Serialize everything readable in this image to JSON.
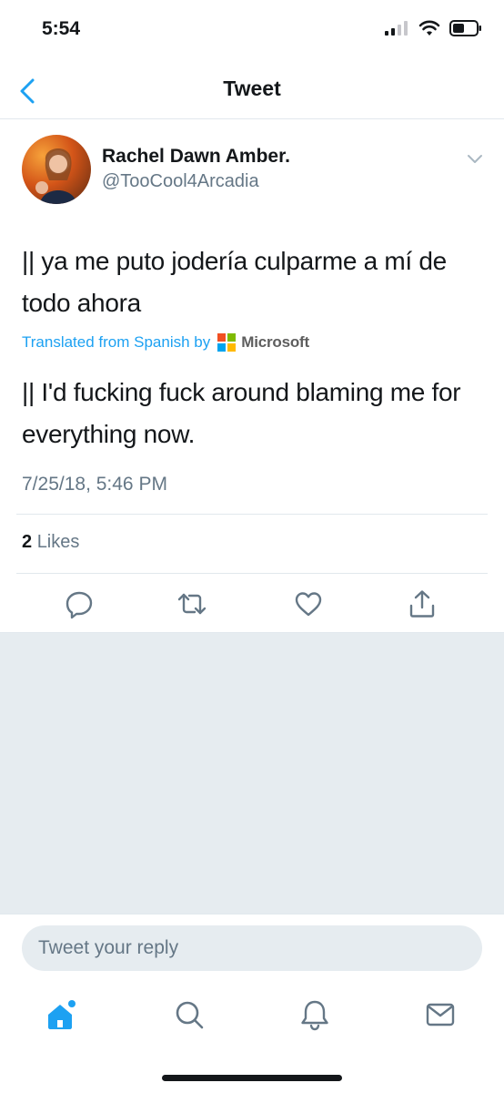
{
  "status_bar": {
    "time": "5:54"
  },
  "nav": {
    "title": "Tweet"
  },
  "tweet": {
    "author_name": "Rachel Dawn Amber.",
    "author_handle": "@TooCool4Arcadia",
    "text": "|| ya me puto jodería culparme a mí de todo ahora",
    "translated_label": "Translated from Spanish by",
    "translation_provider": "Microsoft",
    "translation": "|| I'd fucking fuck around blaming me for everything now.",
    "timestamp": "7/25/18, 5:46 PM",
    "likes_count": "2",
    "likes_label": "Likes"
  },
  "reply": {
    "placeholder": "Tweet your reply"
  },
  "icons": {
    "back": "chevron-left-icon",
    "menu": "chevron-down-icon",
    "reply": "reply-icon",
    "retweet": "retweet-icon",
    "like": "heart-icon",
    "share": "share-icon",
    "home": "home-icon",
    "search": "search-icon",
    "notifications": "bell-icon",
    "messages": "mail-icon"
  },
  "colors": {
    "accent": "#1da1f2",
    "muted_text": "#657786",
    "background_gray": "#e6ecf0",
    "icon_gray": "#657786"
  }
}
